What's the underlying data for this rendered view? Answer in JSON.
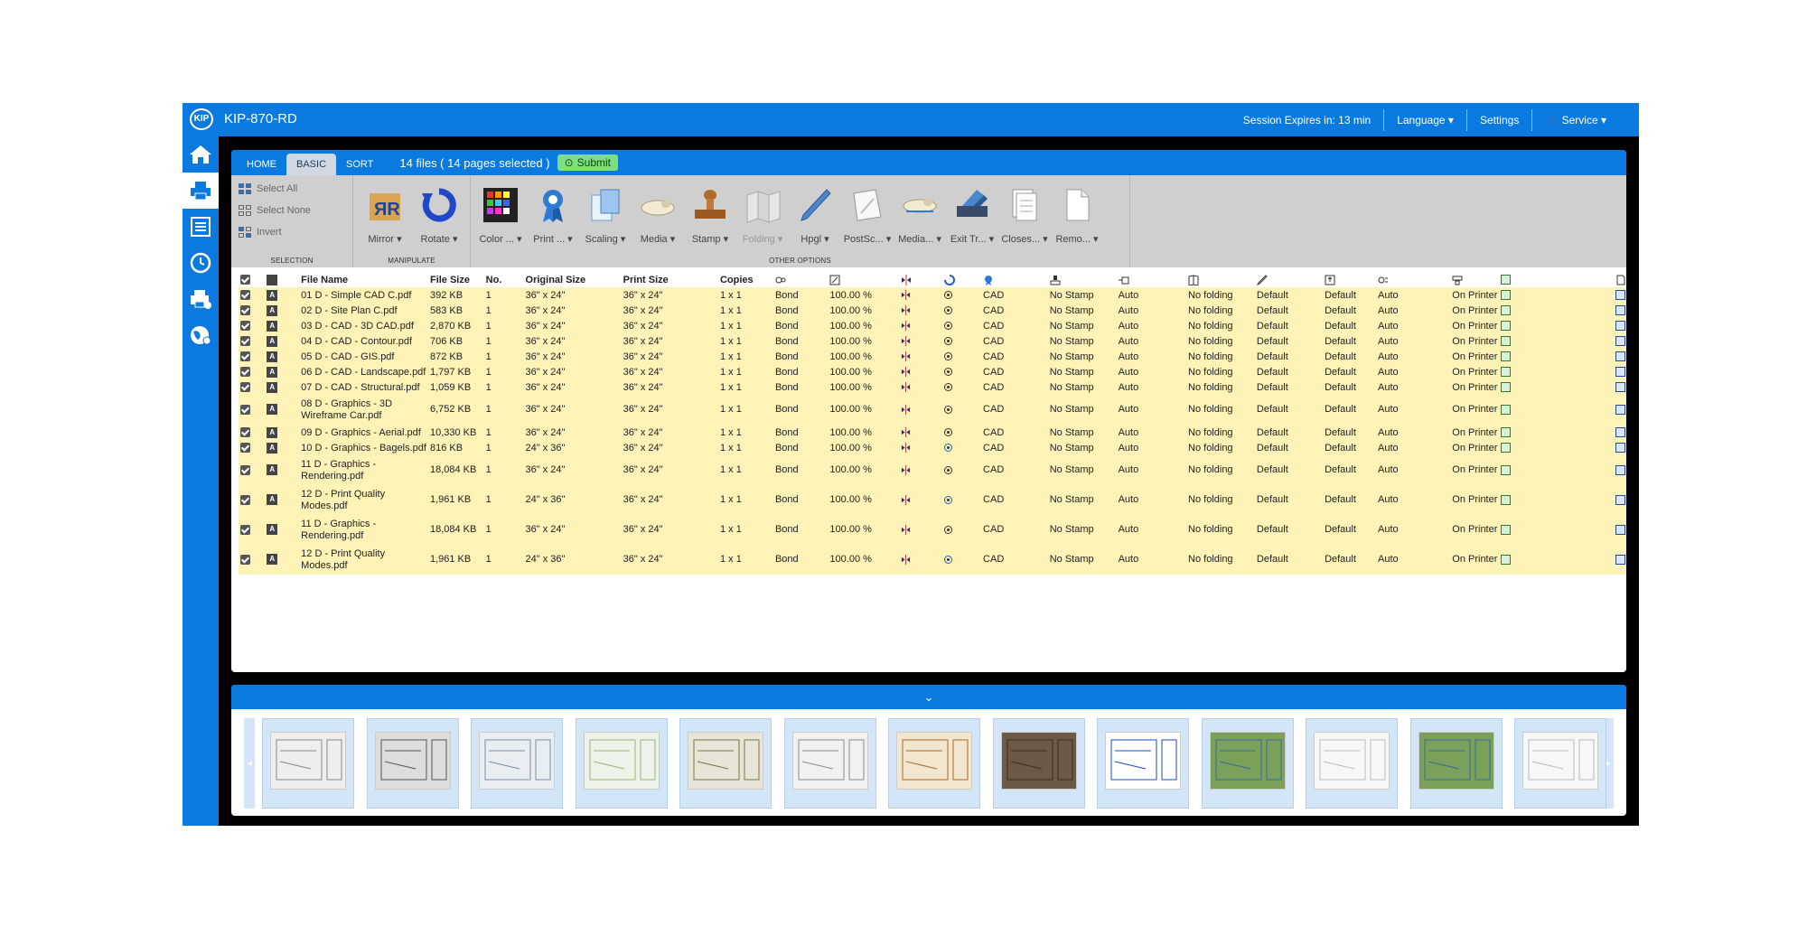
{
  "app": {
    "title": "KIP-870-RD",
    "logo_text": "KIP",
    "session": "Session Expires in: 13 min",
    "language": "Language",
    "settings": "Settings",
    "user": "Service",
    "accent": "#0a7ae0"
  },
  "sidebar": {
    "items": [
      "home-icon",
      "printer-icon",
      "list-icon",
      "clock-icon",
      "print-queue-icon",
      "globe-icon"
    ],
    "active": "printer-icon"
  },
  "tabs": {
    "home": "HOME",
    "basic": "BASIC",
    "sort": "SORT",
    "active": "BASIC"
  },
  "files_info": "14 files ( 14 pages selected )",
  "submit_label": "Submit",
  "toolbar": {
    "selection": {
      "label": "SELECTION",
      "select_all": "Select All",
      "select_none": "Select None",
      "invert": "Invert"
    },
    "manipulate": {
      "label": "MANIPULATE",
      "mirror": "Mirror",
      "rotate": "Rotate"
    },
    "other": {
      "label": "OTHER OPTIONS",
      "color": "Color ...",
      "print": "Print ...",
      "scaling": "Scaling",
      "media": "Media",
      "stamp": "Stamp",
      "folding": "Folding",
      "hpgl": "Hpgl",
      "postsc": "PostSc...",
      "media2": "Media...",
      "exit": "Exit Tr...",
      "closes": "Closes...",
      "remo": "Remo..."
    }
  },
  "table": {
    "headers": {
      "file_name": "File Name",
      "file_size": "File Size",
      "no": "No.",
      "original_size": "Original Size",
      "print_size": "Print Size",
      "copies": "Copies"
    },
    "rows": [
      {
        "name": "01 D - Simple CAD C.pdf",
        "size": "392 KB",
        "no": "1",
        "orig": "36\" x 24\"",
        "print": "36\" x 24\"",
        "copies": "1 x 1",
        "media": "Bond",
        "scale": "100.00 %",
        "rot": false,
        "mode": "CAD",
        "stamp": "No Stamp",
        "auto": "Auto",
        "fold": "No folding",
        "d1": "Default",
        "d2": "Default",
        "auto2": "Auto",
        "printer": "On Printer",
        "tall": false
      },
      {
        "name": "02 D - Site Plan C.pdf",
        "size": "583 KB",
        "no": "1",
        "orig": "36\" x 24\"",
        "print": "36\" x 24\"",
        "copies": "1 x 1",
        "media": "Bond",
        "scale": "100.00 %",
        "rot": false,
        "mode": "CAD",
        "stamp": "No Stamp",
        "auto": "Auto",
        "fold": "No folding",
        "d1": "Default",
        "d2": "Default",
        "auto2": "Auto",
        "printer": "On Printer",
        "tall": false
      },
      {
        "name": "03 D - CAD - 3D CAD.pdf",
        "size": "2,870 KB",
        "no": "1",
        "orig": "36\" x 24\"",
        "print": "36\" x 24\"",
        "copies": "1 x 1",
        "media": "Bond",
        "scale": "100.00 %",
        "rot": false,
        "mode": "CAD",
        "stamp": "No Stamp",
        "auto": "Auto",
        "fold": "No folding",
        "d1": "Default",
        "d2": "Default",
        "auto2": "Auto",
        "printer": "On Printer",
        "tall": false
      },
      {
        "name": "04 D - CAD - Contour.pdf",
        "size": "706 KB",
        "no": "1",
        "orig": "36\" x 24\"",
        "print": "36\" x 24\"",
        "copies": "1 x 1",
        "media": "Bond",
        "scale": "100.00 %",
        "rot": false,
        "mode": "CAD",
        "stamp": "No Stamp",
        "auto": "Auto",
        "fold": "No folding",
        "d1": "Default",
        "d2": "Default",
        "auto2": "Auto",
        "printer": "On Printer",
        "tall": false
      },
      {
        "name": "05 D - CAD - GIS.pdf",
        "size": "872 KB",
        "no": "1",
        "orig": "36\" x 24\"",
        "print": "36\" x 24\"",
        "copies": "1 x 1",
        "media": "Bond",
        "scale": "100.00 %",
        "rot": false,
        "mode": "CAD",
        "stamp": "No Stamp",
        "auto": "Auto",
        "fold": "No folding",
        "d1": "Default",
        "d2": "Default",
        "auto2": "Auto",
        "printer": "On Printer",
        "tall": false
      },
      {
        "name": "06 D - CAD - Landscape.pdf",
        "size": "1,797 KB",
        "no": "1",
        "orig": "36\" x 24\"",
        "print": "36\" x 24\"",
        "copies": "1 x 1",
        "media": "Bond",
        "scale": "100.00 %",
        "rot": false,
        "mode": "CAD",
        "stamp": "No Stamp",
        "auto": "Auto",
        "fold": "No folding",
        "d1": "Default",
        "d2": "Default",
        "auto2": "Auto",
        "printer": "On Printer",
        "tall": false
      },
      {
        "name": "07 D - CAD - Structural.pdf",
        "size": "1,059 KB",
        "no": "1",
        "orig": "36\" x 24\"",
        "print": "36\" x 24\"",
        "copies": "1 x 1",
        "media": "Bond",
        "scale": "100.00 %",
        "rot": false,
        "mode": "CAD",
        "stamp": "No Stamp",
        "auto": "Auto",
        "fold": "No folding",
        "d1": "Default",
        "d2": "Default",
        "auto2": "Auto",
        "printer": "On Printer",
        "tall": false
      },
      {
        "name": "08 D - Graphics - 3D Wireframe Car.pdf",
        "size": "6,752 KB",
        "no": "1",
        "orig": "36\" x 24\"",
        "print": "36\" x 24\"",
        "copies": "1 x 1",
        "media": "Bond",
        "scale": "100.00 %",
        "rot": false,
        "mode": "CAD",
        "stamp": "No Stamp",
        "auto": "Auto",
        "fold": "No folding",
        "d1": "Default",
        "d2": "Default",
        "auto2": "Auto",
        "printer": "On Printer",
        "tall": true
      },
      {
        "name": "09 D - Graphics - Aerial.pdf",
        "size": "10,330 KB",
        "no": "1",
        "orig": "36\" x 24\"",
        "print": "36\" x 24\"",
        "copies": "1 x 1",
        "media": "Bond",
        "scale": "100.00 %",
        "rot": false,
        "mode": "CAD",
        "stamp": "No Stamp",
        "auto": "Auto",
        "fold": "No folding",
        "d1": "Default",
        "d2": "Default",
        "auto2": "Auto",
        "printer": "On Printer",
        "tall": false
      },
      {
        "name": "10 D - Graphics - Bagels.pdf",
        "size": "816 KB",
        "no": "1",
        "orig": "24\" x 36\"",
        "print": "36\" x 24\"",
        "copies": "1 x 1",
        "media": "Bond",
        "scale": "100.00 %",
        "rot": true,
        "mode": "CAD",
        "stamp": "No Stamp",
        "auto": "Auto",
        "fold": "No folding",
        "d1": "Default",
        "d2": "Default",
        "auto2": "Auto",
        "printer": "On Printer",
        "tall": false
      },
      {
        "name": "11 D - Graphics - Rendering.pdf",
        "size": "18,084 KB",
        "no": "1",
        "orig": "36\" x 24\"",
        "print": "36\" x 24\"",
        "copies": "1 x 1",
        "media": "Bond",
        "scale": "100.00 %",
        "rot": false,
        "mode": "CAD",
        "stamp": "No Stamp",
        "auto": "Auto",
        "fold": "No folding",
        "d1": "Default",
        "d2": "Default",
        "auto2": "Auto",
        "printer": "On Printer",
        "tall": true
      },
      {
        "name": "12 D - Print Quality Modes.pdf",
        "size": "1,961 KB",
        "no": "1",
        "orig": "24\" x 36\"",
        "print": "36\" x 24\"",
        "copies": "1 x 1",
        "media": "Bond",
        "scale": "100.00 %",
        "rot": true,
        "mode": "CAD",
        "stamp": "No Stamp",
        "auto": "Auto",
        "fold": "No folding",
        "d1": "Default",
        "d2": "Default",
        "auto2": "Auto",
        "printer": "On Printer",
        "tall": true
      },
      {
        "name": "11 D - Graphics - Rendering.pdf",
        "size": "18,084 KB",
        "no": "1",
        "orig": "36\" x 24\"",
        "print": "36\" x 24\"",
        "copies": "1 x 1",
        "media": "Bond",
        "scale": "100.00 %",
        "rot": false,
        "mode": "CAD",
        "stamp": "No Stamp",
        "auto": "Auto",
        "fold": "No folding",
        "d1": "Default",
        "d2": "Default",
        "auto2": "Auto",
        "printer": "On Printer",
        "tall": true
      },
      {
        "name": "12 D - Print Quality Modes.pdf",
        "size": "1,961 KB",
        "no": "1",
        "orig": "24\" x 36\"",
        "print": "36\" x 24\"",
        "copies": "1 x 1",
        "media": "Bond",
        "scale": "100.00 %",
        "rot": true,
        "mode": "CAD",
        "stamp": "No Stamp",
        "auto": "Auto",
        "fold": "No folding",
        "d1": "Default",
        "d2": "Default",
        "auto2": "Auto",
        "printer": "On Printer",
        "tall": true
      }
    ]
  },
  "thumbnails": {
    "items": [
      "cad-drawing",
      "mechanical-parts",
      "site-plan",
      "contour-map",
      "landscape-plan",
      "structural-plan",
      "bagels",
      "aerial-photo",
      "print-quality",
      "house-rendering",
      "spreadsheet",
      "house-rendering",
      "spreadsheet"
    ]
  }
}
